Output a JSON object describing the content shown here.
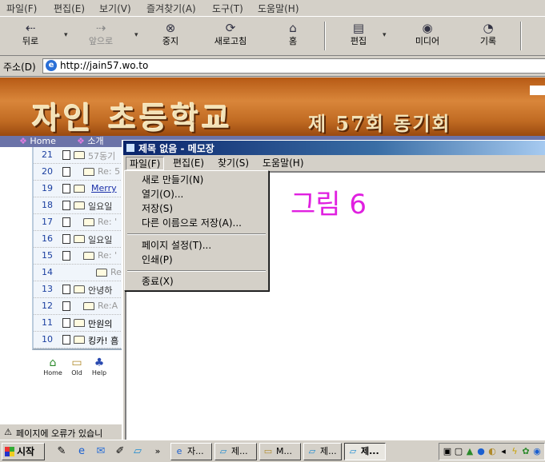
{
  "ie": {
    "menu": [
      "파일(F)",
      "편집(E)",
      "보기(V)",
      "즐겨찾기(A)",
      "도구(T)",
      "도움말(H)"
    ],
    "toolbar": {
      "back": "뒤로",
      "forward": "앞으로",
      "stop": "중지",
      "refresh": "새로고침",
      "home": "홈",
      "edit": "편집",
      "media": "미디어",
      "history": "기록"
    },
    "address_label": "주소(D)",
    "url": "http://jain57.wo.to"
  },
  "site": {
    "banner_title": "자인 초등학교",
    "banner_sub": "제 57회 동기회",
    "nav": [
      "Home",
      "소개"
    ]
  },
  "board": {
    "rows": [
      {
        "num": "21",
        "title": "57동기"
      },
      {
        "num": "20",
        "title": "Re: 5"
      },
      {
        "num": "19",
        "title": "Merry"
      },
      {
        "num": "18",
        "title": "일요일"
      },
      {
        "num": "17",
        "title": "Re: '"
      },
      {
        "num": "16",
        "title": "일요일"
      },
      {
        "num": "15",
        "title": "Re: '"
      },
      {
        "num": "14",
        "title": "Re"
      },
      {
        "num": "13",
        "title": "안녕하"
      },
      {
        "num": "12",
        "title": "Re:A"
      },
      {
        "num": "11",
        "title": "만원의"
      },
      {
        "num": "10",
        "title": "킹카! 흠"
      }
    ],
    "icons": {
      "home": "Home",
      "old": "Old",
      "help": "Help"
    }
  },
  "status_text": "페이지에 오류가 있습니",
  "notepad": {
    "title": "제목 없음 - 메모장",
    "menu": [
      "파일(F)",
      "편집(E)",
      "찾기(S)",
      "도움말(H)"
    ],
    "figure_label": "그림 6",
    "file_menu": [
      "새로 만들기(N)",
      "열기(O)...",
      "저장(S)",
      "다른 이름으로 저장(A)...",
      "페이지 설정(T)...",
      "인쇄(P)",
      "종료(X)"
    ]
  },
  "taskbar": {
    "start": "시작",
    "chevron": "»",
    "tasks": [
      "자...",
      "제...",
      "M...",
      "제...",
      "제..."
    ]
  },
  "colors": {
    "figure_label": "#e020e0",
    "title_bar": "#0a246a",
    "banner": "#c06a22"
  }
}
